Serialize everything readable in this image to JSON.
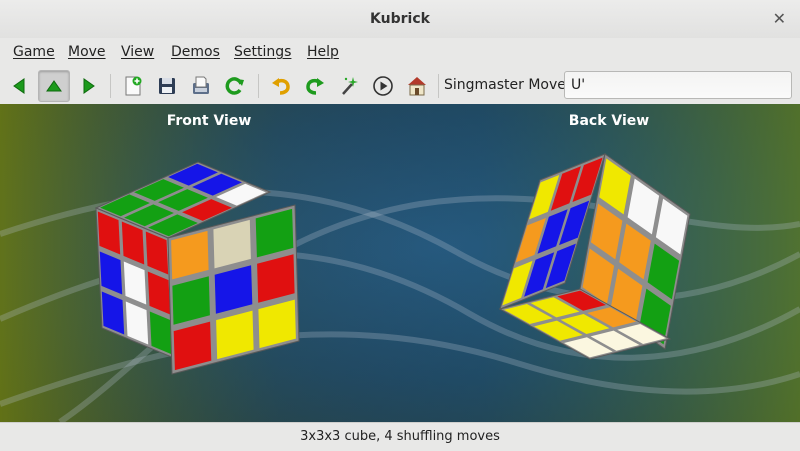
{
  "window": {
    "title": "Kubrick"
  },
  "menu": [
    "Game",
    "Move",
    "View",
    "Demos",
    "Settings",
    "Help"
  ],
  "toolbar": {
    "moves_label": "Singmaster Moves",
    "moves_value": "U'"
  },
  "views": {
    "front_label": "Front View",
    "back_label": "Back View"
  },
  "status": "3x3x3 cube, 4 shuffling moves",
  "colors": {
    "red": "#e01010",
    "green": "#13a013",
    "blue": "#1515e8",
    "white": "#f8f8f8",
    "yellow": "#f0e800",
    "orange": "#f59a1e",
    "cream": "#fbf7e0",
    "sand": "#d9d3b5",
    "frame": "#8e8e8e",
    "bg_center": "#1d4e8c",
    "bg_edge": "#5a6e1e"
  },
  "cubes": {
    "front": {
      "top": [
        "green",
        "green",
        "blue",
        "green",
        "green",
        "blue",
        "green",
        "red",
        "white"
      ],
      "left": [
        "red",
        "red",
        "red",
        "blue",
        "white",
        "red",
        "blue",
        "white",
        "green"
      ],
      "right": [
        "orange",
        "sand",
        "green",
        "green",
        "blue",
        "red",
        "red",
        "yellow",
        "yellow"
      ]
    },
    "back": {
      "top": [
        "yellow",
        "red",
        "red",
        "orange",
        "blue",
        "blue",
        "yellow",
        "blue",
        "blue"
      ],
      "right": [
        "yellow",
        "white",
        "white",
        "orange",
        "orange",
        "green",
        "orange",
        "orange",
        "green"
      ],
      "bottom": [
        "yellow",
        "yellow",
        "red",
        "yellow",
        "yellow",
        "orange",
        "cream",
        "cream",
        "cream"
      ]
    }
  }
}
